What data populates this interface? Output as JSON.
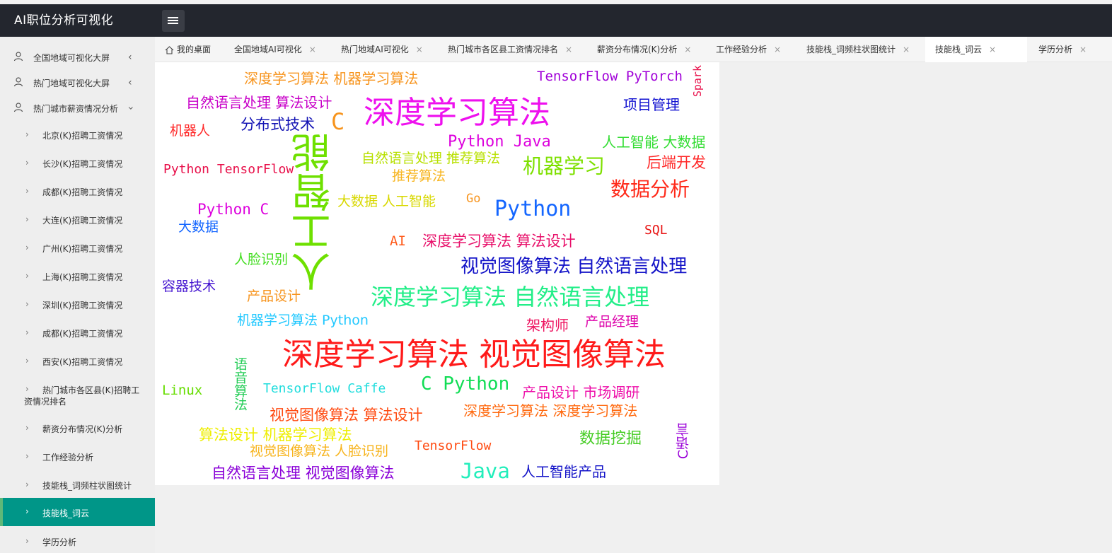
{
  "app": {
    "title": "AI职位分析可视化"
  },
  "sidebar": {
    "groups": [
      {
        "label": "全国地域可视化大屏"
      },
      {
        "label": "热门地域可视化大屏"
      },
      {
        "label": "热门城市薪资情况分析"
      }
    ],
    "items": [
      {
        "label": "北京(K)招聘工资情况"
      },
      {
        "label": "长沙(K)招聘工资情况"
      },
      {
        "label": "成都(K)招聘工资情况"
      },
      {
        "label": "大连(K)招聘工资情况"
      },
      {
        "label": "广州(K)招聘工资情况"
      },
      {
        "label": "上海(K)招聘工资情况"
      },
      {
        "label": "深圳(K)招聘工资情况"
      },
      {
        "label": "成都(K)招聘工资情况"
      },
      {
        "label": "西安(K)招聘工资情况"
      },
      {
        "label_line1": "热门城市各区县(K)招聘工",
        "label_line2": "资情况排名"
      },
      {
        "label": "薪资分布情况(K)分析"
      },
      {
        "label": "工作经验分析"
      },
      {
        "label": "技能栈_词频柱状图统计"
      },
      {
        "label": "技能栈_词云",
        "active": true
      },
      {
        "label": "学历分析"
      }
    ]
  },
  "tabs": [
    {
      "label": "我的桌面"
    },
    {
      "label": "全国地域AI可视化"
    },
    {
      "label": "热门地域AI可视化"
    },
    {
      "label": "热门城市各区县工资情况排名"
    },
    {
      "label": "薪资分布情况(K)分析"
    },
    {
      "label": "工作经验分析"
    },
    {
      "label": "技能栈_词频柱状图统计"
    },
    {
      "label": "技能栈_词云",
      "active": true
    },
    {
      "label": "学历分析"
    }
  ],
  "tab_close_glyph": "×",
  "wordcloud": {
    "words": [
      {
        "text": "深度学习算法 机器学习算法",
        "color": "#f7941d"
      },
      {
        "text": "TensorFlow PyTorch",
        "color": "#a000d8"
      },
      {
        "text": "Spark",
        "color": "#e8104a"
      },
      {
        "text": "自然语言处理 算法设计",
        "color": "#c800c8"
      },
      {
        "text": "深度学习算法",
        "color": "#ee10ee"
      },
      {
        "text": "项目管理",
        "color": "#1010d0"
      },
      {
        "text": "C",
        "color": "#f7941d"
      },
      {
        "text": "机器人",
        "color": "#ff2a2a"
      },
      {
        "text": "分布式技术",
        "color": "#1414b4"
      },
      {
        "text": "人工智能",
        "color": "#6ee000"
      },
      {
        "text": "Python Java",
        "color": "#dd00dd"
      },
      {
        "text": "人工智能 大数据",
        "color": "#33dd33"
      },
      {
        "text": "自然语言处理 推荐算法",
        "color": "#b8e000"
      },
      {
        "text": "Python TensorFlow",
        "color": "#e8104a"
      },
      {
        "text": "机器学习",
        "color": "#7ee000"
      },
      {
        "text": "后端开发",
        "color": "#ff2a2a"
      },
      {
        "text": "推荐算法",
        "color": "#f7b41d"
      },
      {
        "text": "数据分析",
        "color": "#ff2a1a"
      },
      {
        "text": "大数据 人工智能",
        "color": "#d8d800"
      },
      {
        "text": "Go",
        "color": "#f7941d"
      },
      {
        "text": "Python C",
        "color": "#dd00dd"
      },
      {
        "text": "Python",
        "color": "#1466ff"
      },
      {
        "text": "大数据",
        "color": "#1466ff"
      },
      {
        "text": "SQL",
        "color": "#e81414"
      },
      {
        "text": "AI",
        "color": "#ff5a1a"
      },
      {
        "text": "深度学习算法 算法设计",
        "color": "#e8106a"
      },
      {
        "text": "人脸识别",
        "color": "#44dd22"
      },
      {
        "text": "视觉图像算法 自然语言处理",
        "color": "#1414c8"
      },
      {
        "text": "容器技术",
        "color": "#4414d0"
      },
      {
        "text": "产品设计",
        "color": "#f7941d"
      },
      {
        "text": "深度学习算法 自然语言处理",
        "color": "#22ee88"
      },
      {
        "text": "机器学习算法 Python",
        "color": "#22c8ff"
      },
      {
        "text": "架构师",
        "color": "#ee1460"
      },
      {
        "text": "产品经理",
        "color": "#dd00aa"
      },
      {
        "text": "深度学习算法 视觉图像算法",
        "color": "#ff1a1a"
      },
      {
        "text": "语音算法",
        "color": "#22cc55"
      },
      {
        "text": "Linux",
        "color": "#66dd00"
      },
      {
        "text": "TensorFlow Caffe",
        "color": "#22dddd"
      },
      {
        "text": "C Python",
        "color": "#11dd55"
      },
      {
        "text": "产品设计 市场调研",
        "color": "#ee10aa"
      },
      {
        "text": "视觉图像算法 算法设计",
        "color": "#ff4a10"
      },
      {
        "text": "深度学习算法 深度学习算法",
        "color": "#ff6a10"
      },
      {
        "text": "算法设计 机器学习算法",
        "color": "#eeee00"
      },
      {
        "text": "数据挖掘",
        "color": "#44cc22"
      },
      {
        "text": "C语言",
        "color": "#9a00d8"
      },
      {
        "text": "视觉图像算法 人脸识别",
        "color": "#f7b41d"
      },
      {
        "text": "TensorFlow",
        "color": "#ff4a10"
      },
      {
        "text": "自然语言处理 视觉图像算法",
        "color": "#8a00d8"
      },
      {
        "text": "Java",
        "color": "#22eebb"
      },
      {
        "text": "人工智能产品",
        "color": "#1414c8"
      }
    ]
  }
}
